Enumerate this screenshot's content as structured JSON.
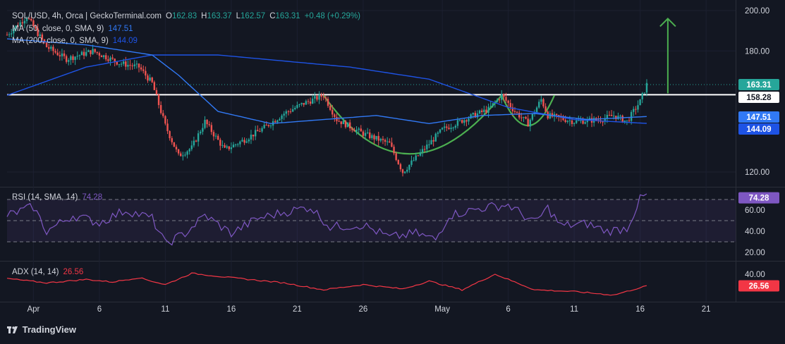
{
  "header": {
    "symbol": "SOL/USD, 4h, Orca | GeckoTerminal.com",
    "o_label": "O",
    "o": "162.83",
    "h_label": "H",
    "h": "163.37",
    "l_label": "L",
    "l": "162.57",
    "c_label": "C",
    "c": "163.31",
    "change": "+0.48 (+0.29%)"
  },
  "ma_legend": [
    {
      "label": "MA (50, close, 0, SMA, 9)",
      "value": "147.51",
      "color": "#3179f5"
    },
    {
      "label": "MA (200, close, 0, SMA, 9)",
      "value": "144.09",
      "color": "#1e53e5"
    }
  ],
  "rsi_legend": {
    "label": "RSI (14, SMA, 14)",
    "value": "74.28"
  },
  "adx_legend": {
    "label": "ADX (14, 14)",
    "value": "26.56"
  },
  "brand": "TradingView",
  "colors": {
    "up": "#26a69a",
    "down": "#ef5350",
    "ma50": "#3179f5",
    "ma200": "#1e53e5",
    "rsi": "#7e57c2",
    "adx": "#f23645",
    "pattern": "#4caf50",
    "arrow": "#4caf50",
    "resistance": "#ffffff"
  },
  "chart_data": [
    {
      "type": "candlestick",
      "title": "SOL/USD, 4h, Orca | GeckoTerminal.com",
      "x_ticks": [
        "Apr",
        "6",
        "11",
        "16",
        "21",
        "26",
        "May",
        "6",
        "11",
        "16",
        "21"
      ],
      "y_ticks": [
        "200.00",
        "180.00",
        "120.00"
      ],
      "ylim": [
        110,
        203
      ],
      "price_badges": [
        {
          "value": "163.31",
          "color": "#26a69a"
        },
        {
          "value": "158.28",
          "color": "#ffffff"
        },
        {
          "value": "147.51",
          "color": "#3179f5"
        },
        {
          "value": "144.09",
          "color": "#1e53e5"
        }
      ],
      "resistance_level": 158.28,
      "last_price": 163.31,
      "price_path": [
        {
          "day": 0,
          "price": 188
        },
        {
          "day": 1.5,
          "price": 197
        },
        {
          "day": 3,
          "price": 182
        },
        {
          "day": 4.5,
          "price": 176
        },
        {
          "day": 6.5,
          "price": 180
        },
        {
          "day": 8.5,
          "price": 174
        },
        {
          "day": 10,
          "price": 172
        },
        {
          "day": 11,
          "price": 164
        },
        {
          "day": 12,
          "price": 143
        },
        {
          "day": 13,
          "price": 128
        },
        {
          "day": 14,
          "price": 132
        },
        {
          "day": 15,
          "price": 145
        },
        {
          "day": 16.5,
          "price": 131
        },
        {
          "day": 18,
          "price": 136
        },
        {
          "day": 19.5,
          "price": 142
        },
        {
          "day": 21,
          "price": 149
        },
        {
          "day": 22.5,
          "price": 154
        },
        {
          "day": 24,
          "price": 158
        },
        {
          "day": 25,
          "price": 146
        },
        {
          "day": 27,
          "price": 139
        },
        {
          "day": 29,
          "price": 134
        },
        {
          "day": 30,
          "price": 120
        },
        {
          "day": 31,
          "price": 127
        },
        {
          "day": 33,
          "price": 141
        },
        {
          "day": 35,
          "price": 147
        },
        {
          "day": 36.5,
          "price": 151
        },
        {
          "day": 37.5,
          "price": 158
        },
        {
          "day": 38.5,
          "price": 150
        },
        {
          "day": 39.5,
          "price": 144
        },
        {
          "day": 40.5,
          "price": 156
        },
        {
          "day": 41,
          "price": 148
        },
        {
          "day": 43,
          "price": 145
        },
        {
          "day": 45,
          "price": 146
        },
        {
          "day": 46,
          "price": 148
        },
        {
          "day": 47,
          "price": 145
        },
        {
          "day": 48,
          "price": 155
        },
        {
          "day": 48.5,
          "price": 163.3
        }
      ],
      "ma50_path": [
        {
          "day": 0,
          "price": 186
        },
        {
          "day": 6,
          "price": 183
        },
        {
          "day": 11,
          "price": 178
        },
        {
          "day": 13,
          "price": 168
        },
        {
          "day": 16,
          "price": 150
        },
        {
          "day": 20,
          "price": 144
        },
        {
          "day": 24,
          "price": 146
        },
        {
          "day": 28,
          "price": 148
        },
        {
          "day": 32,
          "price": 144
        },
        {
          "day": 36,
          "price": 148
        },
        {
          "day": 40,
          "price": 149
        },
        {
          "day": 44,
          "price": 146
        },
        {
          "day": 48.5,
          "price": 147.5
        }
      ],
      "ma200_path": [
        {
          "day": 0,
          "price": 158
        },
        {
          "day": 6,
          "price": 172
        },
        {
          "day": 11,
          "price": 178
        },
        {
          "day": 16,
          "price": 178
        },
        {
          "day": 21,
          "price": 175
        },
        {
          "day": 26,
          "price": 172
        },
        {
          "day": 32,
          "price": 166
        },
        {
          "day": 38,
          "price": 152
        },
        {
          "day": 43,
          "price": 146
        },
        {
          "day": 48.5,
          "price": 144.1
        }
      ]
    },
    {
      "type": "line",
      "title": "RSI (14, SMA, 14)",
      "y_ticks": [
        "60.00",
        "40.00",
        "20.00"
      ],
      "ylim": [
        15,
        85
      ],
      "bands": [
        70,
        50,
        30
      ],
      "value": 74.28,
      "series": [
        {
          "name": "RSI",
          "points": [
            {
              "day": 0,
              "value": 55
            },
            {
              "day": 2,
              "value": 63
            },
            {
              "day": 3,
              "value": 40
            },
            {
              "day": 5,
              "value": 55
            },
            {
              "day": 7,
              "value": 48
            },
            {
              "day": 9,
              "value": 60
            },
            {
              "day": 11,
              "value": 52
            },
            {
              "day": 12,
              "value": 28
            },
            {
              "day": 13.5,
              "value": 38
            },
            {
              "day": 15,
              "value": 55
            },
            {
              "day": 17,
              "value": 38
            },
            {
              "day": 19,
              "value": 52
            },
            {
              "day": 21,
              "value": 58
            },
            {
              "day": 23,
              "value": 63
            },
            {
              "day": 24.5,
              "value": 44
            },
            {
              "day": 27,
              "value": 46
            },
            {
              "day": 29,
              "value": 34
            },
            {
              "day": 31,
              "value": 38
            },
            {
              "day": 32.5,
              "value": 32
            },
            {
              "day": 33.5,
              "value": 55
            },
            {
              "day": 36,
              "value": 62
            },
            {
              "day": 38,
              "value": 65
            },
            {
              "day": 40,
              "value": 48
            },
            {
              "day": 41,
              "value": 62
            },
            {
              "day": 42,
              "value": 45
            },
            {
              "day": 44,
              "value": 47
            },
            {
              "day": 45.5,
              "value": 40
            },
            {
              "day": 47,
              "value": 43
            },
            {
              "day": 48,
              "value": 70
            },
            {
              "day": 48.5,
              "value": 74.28
            }
          ]
        }
      ]
    },
    {
      "type": "line",
      "title": "ADX (14, 14)",
      "y_ticks": [
        "40.00"
      ],
      "ylim": [
        15,
        50
      ],
      "value": 26.56,
      "series": [
        {
          "name": "ADX",
          "points": [
            {
              "day": 0,
              "value": 35
            },
            {
              "day": 3,
              "value": 30
            },
            {
              "day": 6,
              "value": 34
            },
            {
              "day": 8,
              "value": 31
            },
            {
              "day": 10,
              "value": 36
            },
            {
              "day": 12,
              "value": 28
            },
            {
              "day": 14,
              "value": 41
            },
            {
              "day": 17,
              "value": 36
            },
            {
              "day": 21,
              "value": 30
            },
            {
              "day": 24,
              "value": 22
            },
            {
              "day": 27,
              "value": 28
            },
            {
              "day": 30,
              "value": 23
            },
            {
              "day": 32,
              "value": 32
            },
            {
              "day": 34.5,
              "value": 22
            },
            {
              "day": 37,
              "value": 40
            },
            {
              "day": 40,
              "value": 22
            },
            {
              "day": 43,
              "value": 20
            },
            {
              "day": 46,
              "value": 16
            },
            {
              "day": 48.5,
              "value": 26.56
            }
          ]
        }
      ]
    }
  ]
}
